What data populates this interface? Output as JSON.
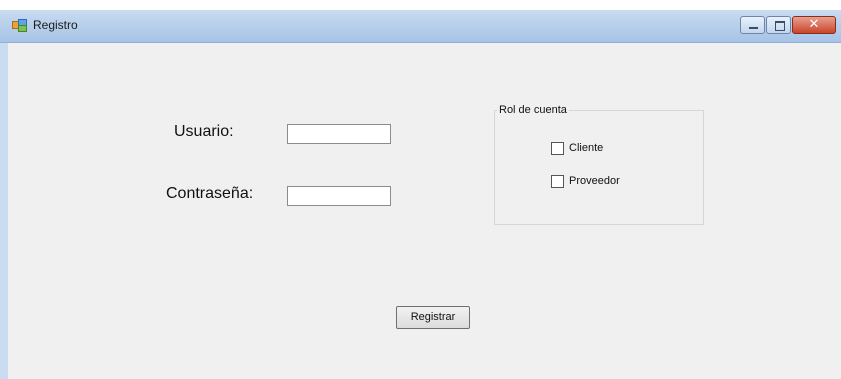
{
  "window": {
    "title": "Registro",
    "close_glyph": "✕"
  },
  "form": {
    "usuario_label": "Usuario:",
    "usuario_value": "",
    "contrasena_label": "Contraseña:",
    "contrasena_value": ""
  },
  "role_group": {
    "title": "Rol de cuenta",
    "options": [
      {
        "label": "Cliente",
        "checked": false
      },
      {
        "label": "Proveedor",
        "checked": false
      }
    ]
  },
  "actions": {
    "register_label": "Registrar"
  }
}
